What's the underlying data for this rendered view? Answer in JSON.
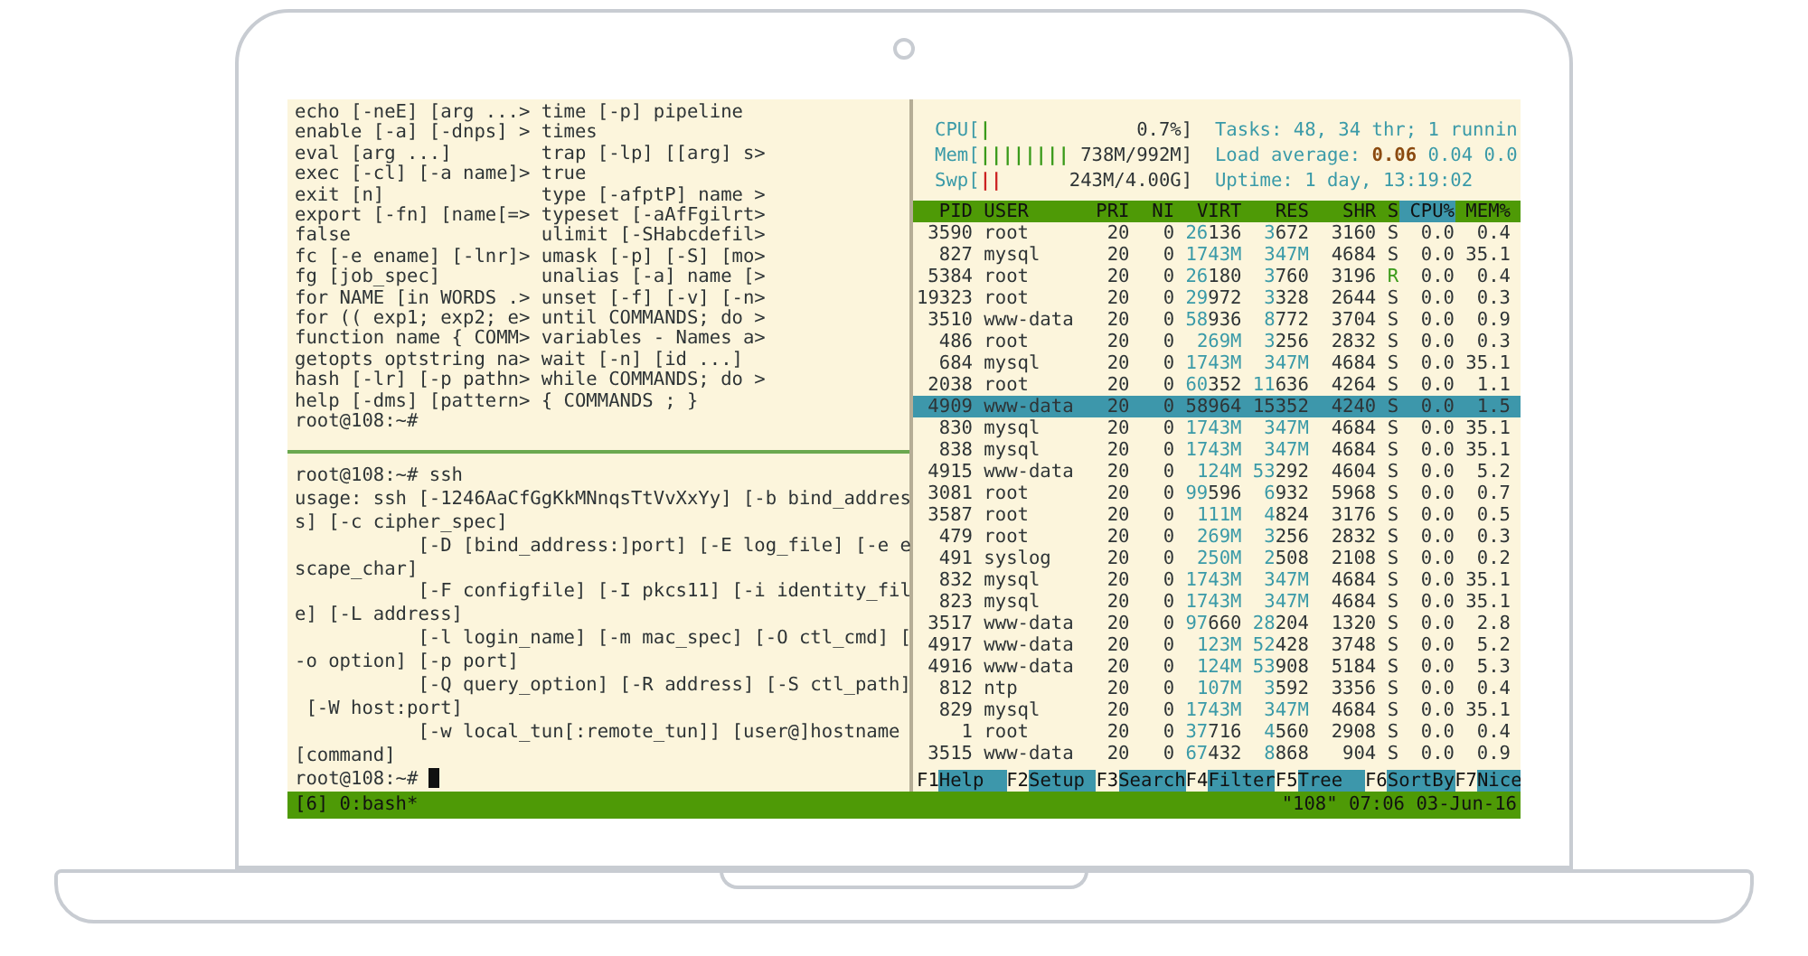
{
  "help_pane": {
    "rows": [
      {
        "left": "echo [-neE] [arg ...>",
        "right": "time [-p] pipeline"
      },
      {
        "left": "enable [-a] [-dnps] >",
        "right": "times"
      },
      {
        "left": "eval [arg ...]",
        "right": "trap [-lp] [[arg] s>"
      },
      {
        "left": "exec [-cl] [-a name]>",
        "right": "true"
      },
      {
        "left": "exit [n]",
        "right": "type [-afptP] name >"
      },
      {
        "left": "export [-fn] [name[=>",
        "right": "typeset [-aAfFgilrt>"
      },
      {
        "left": "false",
        "right": "ulimit [-SHabcdefil>"
      },
      {
        "left": "fc [-e ename] [-lnr]>",
        "right": "umask [-p] [-S] [mo>"
      },
      {
        "left": "fg [job_spec]",
        "right": "unalias [-a] name [>"
      },
      {
        "left": "for NAME [in WORDS .>",
        "right": "unset [-f] [-v] [-n>"
      },
      {
        "left": "for (( exp1; exp2; e>",
        "right": "until COMMANDS; do >"
      },
      {
        "left": "function name { COMM>",
        "right": "variables - Names a>"
      },
      {
        "left": "getopts optstring na>",
        "right": "wait [-n] [id ...]"
      },
      {
        "left": "hash [-lr] [-p pathn>",
        "right": "while COMMANDS; do >"
      },
      {
        "left": "help [-dms] [pattern>",
        "right": "{ COMMANDS ; }"
      }
    ],
    "prompt": "root@108:~#"
  },
  "ssh_pane": {
    "lines": [
      "root@108:~# ssh",
      "usage: ssh [-1246AaCfGgKkMNnqsTtVvXxYy] [-b bind_addres",
      "s] [-c cipher_spec]",
      "           [-D [bind_address:]port] [-E log_file] [-e e",
      "scape_char]",
      "           [-F configfile] [-I pkcs11] [-i identity_fil",
      "e] [-L address]",
      "           [-l login_name] [-m mac_spec] [-O ctl_cmd] [",
      "-o option] [-p port]",
      "           [-Q query_option] [-R address] [-S ctl_path]",
      " [-W host:port]",
      "           [-w local_tun[:remote_tun]] [user@]hostname",
      "[command]"
    ],
    "prompt": "root@108:~#"
  },
  "htop": {
    "meters": [
      {
        "label": "CPU[",
        "bars": "|",
        "reading": "0.7%]",
        "color": "#3a9a1a"
      },
      {
        "label": "Mem[",
        "bars": "||||||||",
        "reading": "738M/992M]",
        "color": "#3a9a1a"
      },
      {
        "label": "Swp[",
        "bars": "||",
        "reading": "243M/4.00G]",
        "color": "#cc2222"
      }
    ],
    "info": [
      "Tasks: 48, 34 thr; 1 runnin",
      "Load average: **0.06** 0.04 0.0",
      "Uptime: 1 day, 13:19:02"
    ],
    "columns": [
      {
        "label": "PID",
        "selected": false
      },
      {
        "label": "USER",
        "selected": false
      },
      {
        "label": "PRI",
        "selected": false
      },
      {
        "label": "NI",
        "selected": false
      },
      {
        "label": "VIRT",
        "selected": false
      },
      {
        "label": "RES",
        "selected": false
      },
      {
        "label": "SHR",
        "selected": false
      },
      {
        "label": "S",
        "selected": false
      },
      {
        "label": "CPU%",
        "selected": true
      },
      {
        "label": "MEM%",
        "selected": false
      }
    ],
    "rows": [
      {
        "cells": [
          "3590",
          "root",
          "20",
          "0",
          "26136",
          "3672",
          "3160",
          "S",
          "0.0",
          "0.4"
        ],
        "selected": false
      },
      {
        "cells": [
          "827",
          "mysql",
          "20",
          "0",
          "1743M",
          "347M",
          "4684",
          "S",
          "0.0",
          "35.1"
        ],
        "selected": false
      },
      {
        "cells": [
          "5384",
          "root",
          "20",
          "0",
          "26180",
          "3760",
          "3196",
          "R",
          "0.0",
          "0.4"
        ],
        "selected": false
      },
      {
        "cells": [
          "19323",
          "root",
          "20",
          "0",
          "29972",
          "3328",
          "2644",
          "S",
          "0.0",
          "0.3"
        ],
        "selected": false
      },
      {
        "cells": [
          "3510",
          "www-data",
          "20",
          "0",
          "58936",
          "8772",
          "3704",
          "S",
          "0.0",
          "0.9"
        ],
        "selected": false
      },
      {
        "cells": [
          "486",
          "root",
          "20",
          "0",
          "269M",
          "3256",
          "2832",
          "S",
          "0.0",
          "0.3"
        ],
        "selected": false
      },
      {
        "cells": [
          "684",
          "mysql",
          "20",
          "0",
          "1743M",
          "347M",
          "4684",
          "S",
          "0.0",
          "35.1"
        ],
        "selected": false
      },
      {
        "cells": [
          "2038",
          "root",
          "20",
          "0",
          "60352",
          "11636",
          "4264",
          "S",
          "0.0",
          "1.1"
        ],
        "selected": false
      },
      {
        "cells": [
          "4909",
          "www-data",
          "20",
          "0",
          "58964",
          "15352",
          "4240",
          "S",
          "0.0",
          "1.5"
        ],
        "selected": true
      },
      {
        "cells": [
          "830",
          "mysql",
          "20",
          "0",
          "1743M",
          "347M",
          "4684",
          "S",
          "0.0",
          "35.1"
        ],
        "selected": false
      },
      {
        "cells": [
          "838",
          "mysql",
          "20",
          "0",
          "1743M",
          "347M",
          "4684",
          "S",
          "0.0",
          "35.1"
        ],
        "selected": false
      },
      {
        "cells": [
          "4915",
          "www-data",
          "20",
          "0",
          "124M",
          "53292",
          "4604",
          "S",
          "0.0",
          "5.2"
        ],
        "selected": false
      },
      {
        "cells": [
          "3081",
          "root",
          "20",
          "0",
          "99596",
          "6932",
          "5968",
          "S",
          "0.0",
          "0.7"
        ],
        "selected": false
      },
      {
        "cells": [
          "3587",
          "root",
          "20",
          "0",
          "111M",
          "4824",
          "3176",
          "S",
          "0.0",
          "0.5"
        ],
        "selected": false
      },
      {
        "cells": [
          "479",
          "root",
          "20",
          "0",
          "269M",
          "3256",
          "2832",
          "S",
          "0.0",
          "0.3"
        ],
        "selected": false
      },
      {
        "cells": [
          "491",
          "syslog",
          "20",
          "0",
          "250M",
          "2508",
          "2108",
          "S",
          "0.0",
          "0.2"
        ],
        "selected": false
      },
      {
        "cells": [
          "832",
          "mysql",
          "20",
          "0",
          "1743M",
          "347M",
          "4684",
          "S",
          "0.0",
          "35.1"
        ],
        "selected": false
      },
      {
        "cells": [
          "823",
          "mysql",
          "20",
          "0",
          "1743M",
          "347M",
          "4684",
          "S",
          "0.0",
          "35.1"
        ],
        "selected": false
      },
      {
        "cells": [
          "3517",
          "www-data",
          "20",
          "0",
          "97660",
          "28204",
          "1320",
          "S",
          "0.0",
          "2.8"
        ],
        "selected": false
      },
      {
        "cells": [
          "4917",
          "www-data",
          "20",
          "0",
          "123M",
          "52428",
          "3748",
          "S",
          "0.0",
          "5.2"
        ],
        "selected": false
      },
      {
        "cells": [
          "4916",
          "www-data",
          "20",
          "0",
          "124M",
          "53908",
          "5184",
          "S",
          "0.0",
          "5.3"
        ],
        "selected": false
      },
      {
        "cells": [
          "812",
          "ntp",
          "20",
          "0",
          "107M",
          "3592",
          "3356",
          "S",
          "0.0",
          "0.4"
        ],
        "selected": false
      },
      {
        "cells": [
          "829",
          "mysql",
          "20",
          "0",
          "1743M",
          "347M",
          "4684",
          "S",
          "0.0",
          "35.1"
        ],
        "selected": false
      },
      {
        "cells": [
          "1",
          "root",
          "20",
          "0",
          "37716",
          "4560",
          "2908",
          "S",
          "0.0",
          "0.4"
        ],
        "selected": false
      },
      {
        "cells": [
          "3515",
          "www-data",
          "20",
          "0",
          "67432",
          "8868",
          "904",
          "S",
          "0.0",
          "0.9"
        ],
        "selected": false
      }
    ],
    "function_keys": [
      {
        "key": "F1",
        "label": "Help"
      },
      {
        "key": "F2",
        "label": "Setup"
      },
      {
        "key": "F3",
        "label": "Search"
      },
      {
        "key": "F4",
        "label": "Filter"
      },
      {
        "key": "F5",
        "label": "Tree"
      },
      {
        "key": "F6",
        "label": "SortBy"
      },
      {
        "key": "F7",
        "label": "Nice"
      }
    ]
  },
  "status_bar": {
    "left": "[6] 0:bash*",
    "right": "\"108\" 07:06 03-Jun-16"
  }
}
